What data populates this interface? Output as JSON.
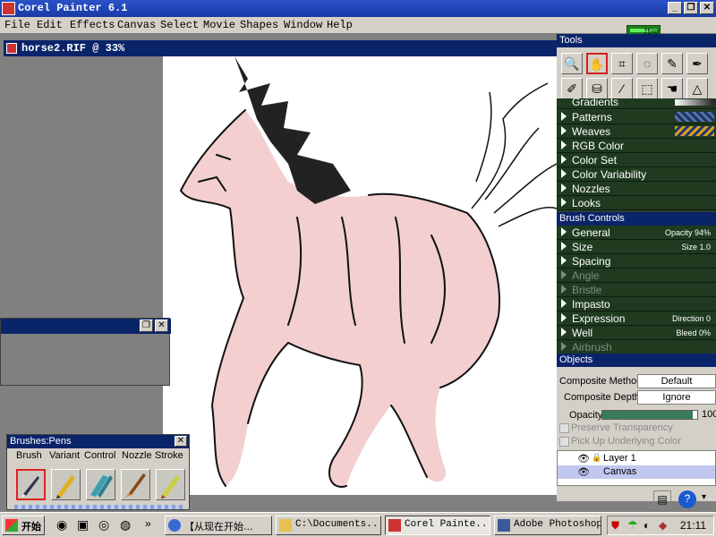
{
  "app": {
    "title": "Corel Painter 6.1"
  },
  "menu": [
    "File",
    "Edit",
    "Effects",
    "Canvas",
    "Select",
    "Movie",
    "Shapes",
    "Window",
    "Help"
  ],
  "document": {
    "title": "horse2.RIF @ 33%"
  },
  "tools_panel": {
    "title": "Tools",
    "battery_pct": "75%"
  },
  "art_materials": {
    "items": [
      {
        "label": "Gradients"
      },
      {
        "label": "Patterns"
      },
      {
        "label": "Weaves"
      },
      {
        "label": "RGB Color"
      },
      {
        "label": "Color Set"
      },
      {
        "label": "Color Variability"
      },
      {
        "label": "Nozzles"
      },
      {
        "label": "Looks"
      }
    ]
  },
  "brush_controls": {
    "title": "Brush Controls",
    "items": [
      {
        "label": "General",
        "value": "Opacity 94%"
      },
      {
        "label": "Size",
        "value": "Size 1.0"
      },
      {
        "label": "Spacing",
        "value": ""
      },
      {
        "label": "Angle",
        "value": ""
      },
      {
        "label": "Bristle",
        "value": ""
      },
      {
        "label": "Impasto",
        "value": ""
      },
      {
        "label": "Expression",
        "value": "Direction 0"
      },
      {
        "label": "Well",
        "value": "Bleed 0%"
      },
      {
        "label": "Airbrush",
        "value": ""
      }
    ]
  },
  "objects": {
    "title": "Objects",
    "composite_method_label": "Composite Method",
    "composite_method": "Default",
    "composite_depth_label": "Composite Depth",
    "composite_depth": "Ignore",
    "opacity_label": "Opacity",
    "opacity_value": "100",
    "opacity_level": 0.95,
    "preserve_transparency": "Preserve Transparency",
    "pick_up_underlying": "Pick Up Underlying Color",
    "layers": [
      "Layer 1",
      "Canvas"
    ]
  },
  "brushes": {
    "title": "Brushes:Pens",
    "tabs": [
      "Brush",
      "Variant",
      "Control",
      "Nozzle",
      "Stroke"
    ]
  },
  "taskbar": {
    "start": "开始",
    "items": [
      {
        "label": "【从现在开始..."
      },
      {
        "label": "C:\\Documents..."
      },
      {
        "label": "Corel Painte..."
      },
      {
        "label": "Adobe Photoshop"
      }
    ],
    "clock": "21:11"
  }
}
